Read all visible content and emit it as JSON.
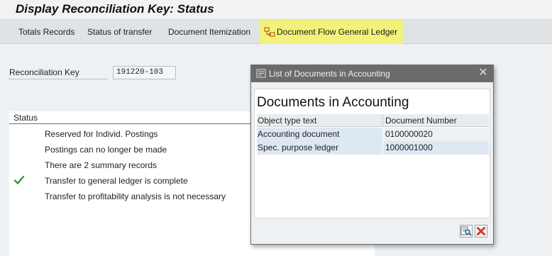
{
  "title": "Display Reconciliation Key: Status",
  "toolbar": {
    "items": [
      {
        "label": "Totals Records"
      },
      {
        "label": "Status of transfer"
      },
      {
        "label": "Document Itemization"
      },
      {
        "label": "Document Flow General Ledger",
        "icon": "document-flow-icon",
        "highlight_color": "#f1f27a"
      }
    ]
  },
  "reconciliation": {
    "label": "Reconciliation Key",
    "value": "191220-103"
  },
  "status": {
    "header": "Status",
    "rows": [
      {
        "text": "Reserved for Individ. Postings",
        "icon": ""
      },
      {
        "text": "Postings can no longer be made",
        "icon": ""
      },
      {
        "text": "There are 2 summary records",
        "icon": ""
      },
      {
        "text": "Transfer to general ledger is complete",
        "icon": "checkmark-icon"
      },
      {
        "text": "Transfer to profitability analysis is not necessary",
        "icon": ""
      }
    ]
  },
  "dialog": {
    "title": "List of Documents in Accounting",
    "heading": "Documents in Accounting",
    "columns": [
      "Object type text",
      "Document Number"
    ],
    "rows": [
      [
        "Accounting document",
        "0100000020"
      ],
      [
        "Spec. purpose ledger",
        "1000001000"
      ]
    ],
    "footer_buttons": [
      "find-icon",
      "cancel-icon"
    ]
  },
  "colors": {
    "highlight": "#f1f27a",
    "check_green": "#3a9a3a",
    "dialog_title_bg": "#6b6b6b",
    "selected_row": "#dde8f3",
    "cancel_red": "#d23a2a"
  }
}
